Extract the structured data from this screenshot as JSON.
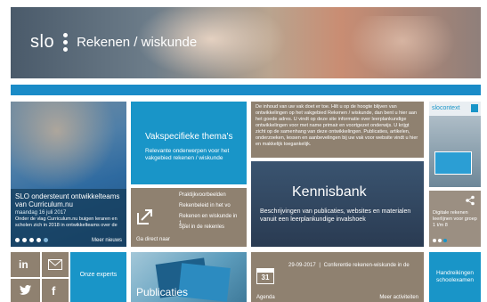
{
  "header": {
    "logo_text": "slo",
    "site_title": "Rekenen / wiskunde"
  },
  "news": {
    "title": "SLO ondersteunt ontwikkelteams van Curriculum.nu",
    "date": "maandag 16 juli 2017",
    "text": "Onder de vlag Curriculum.nu buigen leraren en scholen zich in 2018 in ontwikkelteams over de",
    "more": "Meer nieuws",
    "active_page": 1,
    "page_count": 5
  },
  "tiles": {
    "vakspecifiek": {
      "title": "Vakspecifieke thema's",
      "text": "Relevante onderwerpen voor het vakgebied rekenen / wiskunde"
    },
    "direct": {
      "label": "Ga direct naar",
      "links": [
        "Praktijkvoorbeelden",
        "Rekenbeleid in het vo",
        "Rekenen en wiskunde in 1...",
        "Spel in de rekenles"
      ]
    },
    "intro_text": "De inhoud van uw vak doet er toe. Hilt u op de hoogte blijven van ontwikkelingen op het vakgebied Rekenen / wiskunde, dan bent u hier aan het goede adres. U vindt op deze site informatie over leerplankundige ontwikkelingen voor met name primair en voortgezet onderwijs. U krijgt zicht op de samenhang van deze ontwikkelingen. Publicaties, artikelen, onderzoeken, lessen en aanbevelingen bij uw vak voor website vindt u hier en makkelijk toegankelijk.",
    "kennisbank": {
      "title": "Kennisbank",
      "text": "Beschrijvingen van publicaties, websites en materialen vanuit een leerplankundige invalshoek"
    },
    "slocontext": {
      "brand": "slocontext"
    },
    "digitale": {
      "text": "Digitale rekenen leerlijnen voor groep 1 t/m 8"
    },
    "onze_experts": "Onze experts",
    "publicaties": "Publicaties",
    "agenda": {
      "day": "31",
      "label": "Agenda",
      "date": "29-09-2017",
      "event": "Conferentie rekenen-wiskunde in de",
      "more": "Meer activiteiten"
    },
    "handreikingen": "Handreikingen schoolexamen"
  },
  "social": [
    "linkedin-icon",
    "mail-icon",
    "twitter-icon",
    "facebook-icon"
  ],
  "colors": {
    "teal": "#1995c8",
    "brown": "#8f8170",
    "blue_bar": "#1a8bc7"
  }
}
